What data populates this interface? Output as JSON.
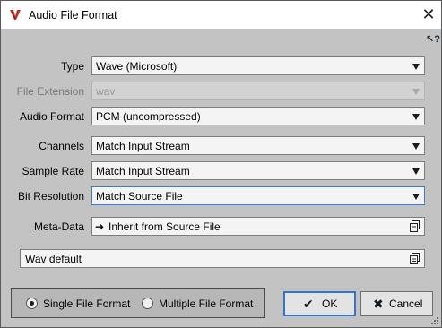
{
  "window": {
    "title": "Audio File Format",
    "close_symbol": "✕",
    "help_symbol": "↖?"
  },
  "form": {
    "type": {
      "label": "Type",
      "value": "Wave (Microsoft)"
    },
    "file_extension": {
      "label": "File Extension",
      "value": "wav",
      "disabled": true
    },
    "audio_format": {
      "label": "Audio Format",
      "value": "PCM (uncompressed)"
    },
    "channels": {
      "label": "Channels",
      "value": "Match Input Stream"
    },
    "sample_rate": {
      "label": "Sample Rate",
      "value": "Match Input Stream"
    },
    "bit_resolution": {
      "label": "Bit Resolution",
      "value": "Match Source File"
    },
    "meta_data": {
      "label": "Meta-Data",
      "value": "Inherit from Source File",
      "arrow_symbol": "➔"
    },
    "preset": {
      "value": "Wav default"
    }
  },
  "format_mode": {
    "single_label": "Single File Format",
    "multiple_label": "Multiple File Format",
    "selected": "single"
  },
  "buttons": {
    "ok_label": "OK",
    "ok_symbol": "✔",
    "cancel_label": "Cancel",
    "cancel_symbol": "✖"
  },
  "colors": {
    "accent": "#3574c9",
    "dialog_background": "#c3c3c3",
    "app_icon": "#c0302c"
  },
  "icons": [
    "app-logo-icon",
    "close-icon",
    "help-cursor-icon",
    "dropdown-arrow-icon",
    "arrow-right-icon",
    "copy-document-icon",
    "checkmark-icon",
    "x-icon",
    "resize-grip-icon"
  ]
}
